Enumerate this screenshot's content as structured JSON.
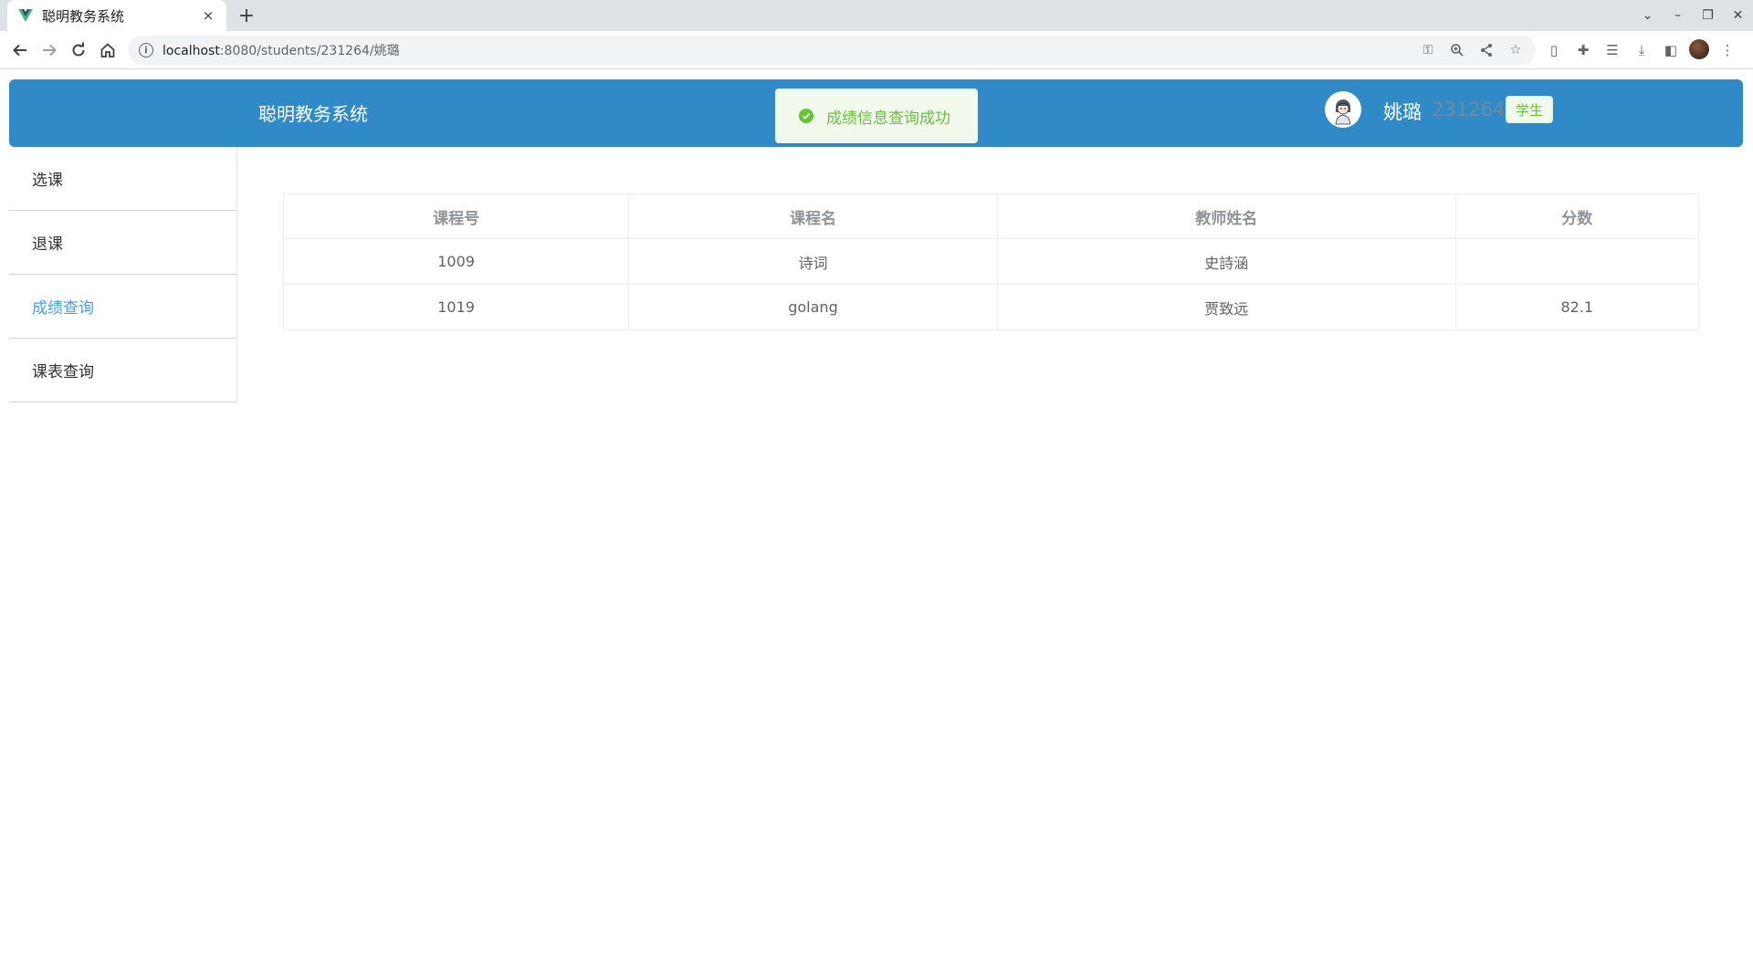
{
  "browser": {
    "tab_title": "聪明教务系统",
    "tab_close": "×",
    "new_tab": "+",
    "url_host": "localhost",
    "url_rest": ":8080/students/231264/姚璐"
  },
  "app": {
    "title": "聪明教务系统",
    "toast_message": "成绩信息查询成功",
    "user": {
      "name": "姚璐",
      "id": "231264",
      "role": "学生"
    }
  },
  "sidebar": {
    "items": [
      {
        "label": "选课"
      },
      {
        "label": "退课"
      },
      {
        "label": "成绩查询",
        "active": true
      },
      {
        "label": "课表查询"
      }
    ]
  },
  "grades_table": {
    "columns": [
      "课程号",
      "课程名",
      "教师姓名",
      "分数"
    ],
    "rows": [
      {
        "course_id": "1009",
        "course_name": "诗词",
        "teacher": "史詩涵",
        "score": ""
      },
      {
        "course_id": "1019",
        "course_name": "golang",
        "teacher": "贾致远",
        "score": "82.1"
      }
    ]
  },
  "colors": {
    "header_bg": "#2f8ac7",
    "active_menu": "#409eff",
    "success": "#67c23a"
  }
}
